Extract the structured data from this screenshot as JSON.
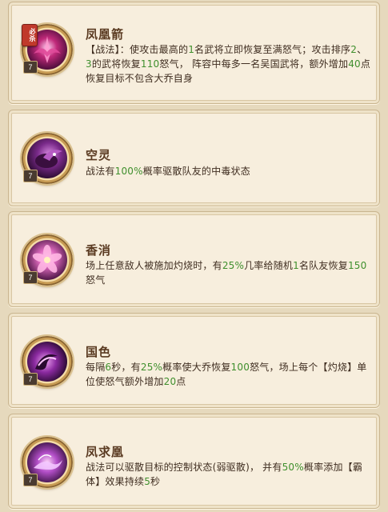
{
  "skills": [
    {
      "title": "凤凰箭",
      "level": "7",
      "badge": "必杀",
      "desc": [
        {
          "t": "【战法】：使攻击最高的"
        },
        {
          "t": "1",
          "g": true
        },
        {
          "t": "名武将立即恢复至满怒气；攻击排序"
        },
        {
          "t": "2",
          "g": true
        },
        {
          "t": "、"
        },
        {
          "t": "3",
          "g": true
        },
        {
          "t": "的武将恢复"
        },
        {
          "t": "110",
          "g": true
        },
        {
          "t": "怒气，   阵容中每多一名吴国武将，额外增加"
        },
        {
          "t": "40",
          "g": true
        },
        {
          "t": "点"
        },
        {
          "br": true
        },
        {
          "t": "恢复目标不包含大乔自身"
        }
      ]
    },
    {
      "title": "空灵",
      "level": "7",
      "desc": [
        {
          "t": "战法有"
        },
        {
          "t": "100%",
          "g": true
        },
        {
          "t": "概率驱散队友的中毒状态"
        }
      ]
    },
    {
      "title": "香消",
      "level": "7",
      "desc": [
        {
          "t": "场上任意敌人被施加灼烧时，有"
        },
        {
          "t": "25%",
          "g": true
        },
        {
          "t": "几率给随机"
        },
        {
          "t": "1",
          "g": true
        },
        {
          "t": "名队友恢复"
        },
        {
          "t": "150",
          "g": true
        },
        {
          "t": "怒气"
        }
      ]
    },
    {
      "title": "国色",
      "level": "7",
      "desc": [
        {
          "t": "每隔"
        },
        {
          "t": "6",
          "g": true
        },
        {
          "t": "秒，有"
        },
        {
          "t": "25%",
          "g": true
        },
        {
          "t": "概率使大乔恢复"
        },
        {
          "t": "100",
          "g": true
        },
        {
          "t": "怒气，场上每个【灼烧】单位使怒气额外增加"
        },
        {
          "t": "20",
          "g": true
        },
        {
          "t": "点"
        }
      ]
    },
    {
      "title": "凤求凰",
      "level": "7",
      "desc": [
        {
          "t": "战法可以驱散目标的控制状态(弱驱散)，  并有"
        },
        {
          "t": "50%",
          "g": true
        },
        {
          "t": "概率添加【霸体】效果持续"
        },
        {
          "t": "5",
          "g": true
        },
        {
          "t": "秒"
        }
      ]
    }
  ]
}
